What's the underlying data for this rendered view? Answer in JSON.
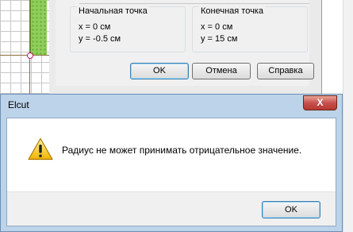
{
  "background_dialog": {
    "start_point": {
      "title": "Начальная точка",
      "x_line": "x = 0 см",
      "y_line": "y = -0.5 см"
    },
    "end_point": {
      "title": "Конечная точка",
      "x_line": "x = 0 см",
      "y_line": "y = 15 см"
    },
    "buttons": {
      "ok": "OK",
      "cancel": "Отмена",
      "help": "Справка"
    }
  },
  "message_box": {
    "title": "Elcut",
    "close_glyph": "X",
    "icon": "warning-icon",
    "message": "Радиус не может принимать отрицательное значение.",
    "ok": "OK"
  }
}
